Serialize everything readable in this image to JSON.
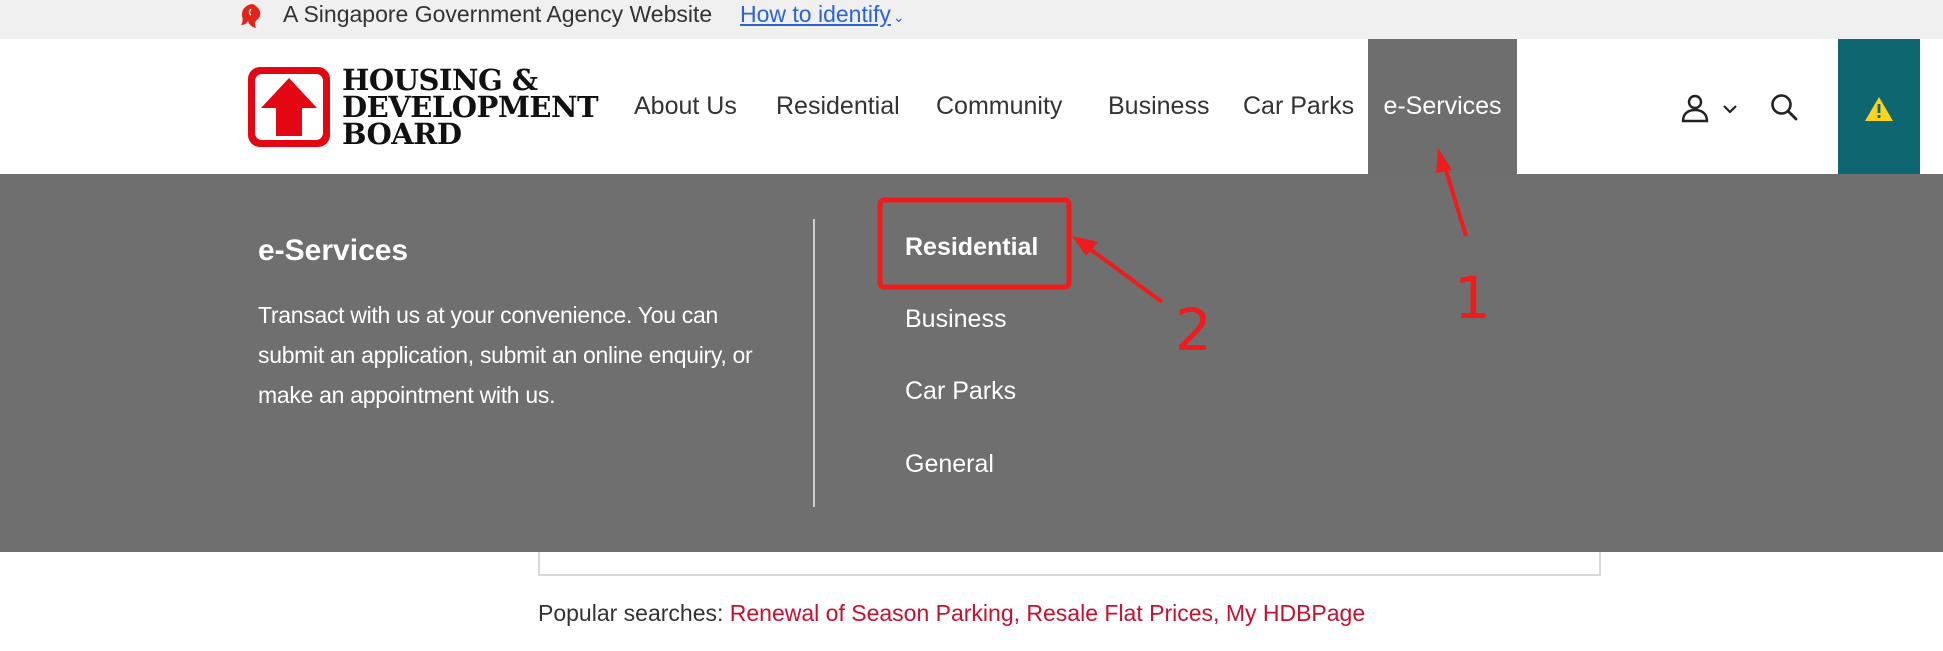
{
  "masthead": {
    "agency_text": "A Singapore Government Agency Website",
    "identify_link": "How to identify"
  },
  "logo": {
    "line1": "HOUSING &",
    "line2": "DEVELOPMENT",
    "line3": "BOARD"
  },
  "nav": {
    "items": [
      "About Us",
      "Residential",
      "Community",
      "Business",
      "Car Parks",
      "e-Services"
    ],
    "active": "e-Services"
  },
  "colors": {
    "brand_red": "#e30613",
    "menu_bg": "#6f6f6f",
    "active_tab": "#6e6e6e",
    "alert_teal": "#0d6670",
    "link_red": "#c8102e",
    "annotation": "#ee1c1c"
  },
  "icons": [
    "lion-head-icon",
    "user-icon",
    "chevron-down-icon",
    "search-icon",
    "warning-icon"
  ],
  "mega_menu": {
    "title": "e-Services",
    "description": "Transact with us at your convenience. You can submit an application, submit an online enquiry, or make an appointment with us.",
    "links": [
      "Residential",
      "Business",
      "Car Parks",
      "General"
    ]
  },
  "popular": {
    "label": "Popular searches:",
    "links": [
      "Renewal of Season Parking",
      "Resale Flat Prices",
      "My HDBPage"
    ]
  },
  "annotations": {
    "label1": "1",
    "label2": "2"
  }
}
